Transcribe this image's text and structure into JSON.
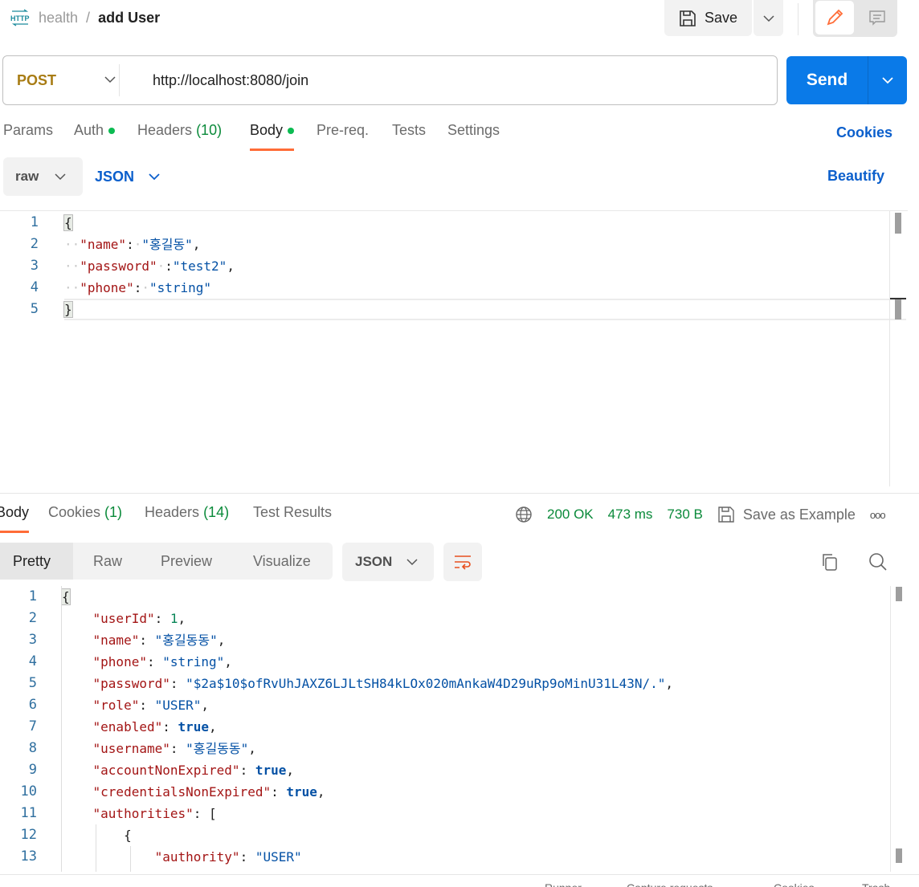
{
  "header": {
    "icon": "http-icon",
    "collection": "health",
    "separator": "/",
    "request_name": "add User",
    "save_label": "Save"
  },
  "request": {
    "method": "POST",
    "url": "http://localhost:8080/join",
    "send_label": "Send"
  },
  "request_tabs": [
    {
      "label": "Params"
    },
    {
      "label": "Auth",
      "dot": true
    },
    {
      "label": "Headers",
      "count": "(10)"
    },
    {
      "label": "Body",
      "dot": true,
      "active": true
    },
    {
      "label": "Pre-req."
    },
    {
      "label": "Tests"
    },
    {
      "label": "Settings"
    }
  ],
  "cookies_link": "Cookies",
  "body_options": {
    "mode": "raw",
    "language": "JSON",
    "beautify": "Beautify"
  },
  "request_body": [
    [
      [
        "brace",
        "{"
      ]
    ],
    [
      [
        "ws",
        "··"
      ],
      [
        "k",
        "\"name\""
      ],
      [
        "p",
        ":"
      ],
      [
        "ws",
        "·"
      ],
      [
        "s",
        "\"홍길동\""
      ],
      [
        "p",
        ","
      ]
    ],
    [
      [
        "ws",
        "··"
      ],
      [
        "k",
        "\"password\""
      ],
      [
        "ws",
        "·"
      ],
      [
        "p",
        ":"
      ],
      [
        "s",
        "\"test2\""
      ],
      [
        "p",
        ","
      ]
    ],
    [
      [
        "ws",
        "··"
      ],
      [
        "k",
        "\"phone\""
      ],
      [
        "p",
        ":"
      ],
      [
        "ws",
        "·"
      ],
      [
        "s",
        "\"string\""
      ]
    ],
    [
      [
        "brace",
        "}"
      ]
    ]
  ],
  "response_tabs": [
    {
      "label": "Body",
      "active": true
    },
    {
      "label": "Cookies",
      "count": "(1)"
    },
    {
      "label": "Headers",
      "count": "(14)"
    },
    {
      "label": "Test Results"
    }
  ],
  "response_meta": {
    "status": "200 OK",
    "time": "473 ms",
    "size": "730 B",
    "save_example": "Save as Example",
    "more": "ooo"
  },
  "response_views": [
    "Pretty",
    "Raw",
    "Preview",
    "Visualize"
  ],
  "response_format": "JSON",
  "response_body": [
    [
      [
        "brace",
        "{"
      ]
    ],
    [
      [
        "p",
        "    "
      ],
      [
        "k",
        "\"userId\""
      ],
      [
        "p",
        ": "
      ],
      [
        "n",
        "1"
      ],
      [
        "p",
        ","
      ]
    ],
    [
      [
        "p",
        "    "
      ],
      [
        "k",
        "\"name\""
      ],
      [
        "p",
        ": "
      ],
      [
        "s",
        "\"홍길동동\""
      ],
      [
        "p",
        ","
      ]
    ],
    [
      [
        "p",
        "    "
      ],
      [
        "k",
        "\"phone\""
      ],
      [
        "p",
        ": "
      ],
      [
        "s",
        "\"string\""
      ],
      [
        "p",
        ","
      ]
    ],
    [
      [
        "p",
        "    "
      ],
      [
        "k",
        "\"password\""
      ],
      [
        "p",
        ": "
      ],
      [
        "s",
        "\"$2a$10$ofRvUhJAXZ6LJLtSH84kLOx020mAnkaW4D29uRp9oMinU31L43N/.\""
      ],
      [
        "p",
        ","
      ]
    ],
    [
      [
        "p",
        "    "
      ],
      [
        "k",
        "\"role\""
      ],
      [
        "p",
        ": "
      ],
      [
        "s",
        "\"USER\""
      ],
      [
        "p",
        ","
      ]
    ],
    [
      [
        "p",
        "    "
      ],
      [
        "k",
        "\"enabled\""
      ],
      [
        "p",
        ": "
      ],
      [
        "b",
        "true"
      ],
      [
        "p",
        ","
      ]
    ],
    [
      [
        "p",
        "    "
      ],
      [
        "k",
        "\"username\""
      ],
      [
        "p",
        ": "
      ],
      [
        "s",
        "\"홍길동동\""
      ],
      [
        "p",
        ","
      ]
    ],
    [
      [
        "p",
        "    "
      ],
      [
        "k",
        "\"accountNonExpired\""
      ],
      [
        "p",
        ": "
      ],
      [
        "b",
        "true"
      ],
      [
        "p",
        ","
      ]
    ],
    [
      [
        "p",
        "    "
      ],
      [
        "k",
        "\"credentialsNonExpired\""
      ],
      [
        "p",
        ": "
      ],
      [
        "b",
        "true"
      ],
      [
        "p",
        ","
      ]
    ],
    [
      [
        "p",
        "    "
      ],
      [
        "k",
        "\"authorities\""
      ],
      [
        "p",
        ": ["
      ]
    ],
    [
      [
        "p",
        "        {"
      ]
    ],
    [
      [
        "p",
        "            "
      ],
      [
        "k",
        "\"authority\""
      ],
      [
        "p",
        ": "
      ],
      [
        "s",
        "\"USER\""
      ]
    ]
  ],
  "footer": [
    "Runner",
    "Capture requests",
    "Cookies",
    "Trash"
  ],
  "colors": {
    "accent": "#ff6c37",
    "send": "#0a7ae8",
    "link": "#0b5fcc",
    "status": "#0a8a3a"
  }
}
